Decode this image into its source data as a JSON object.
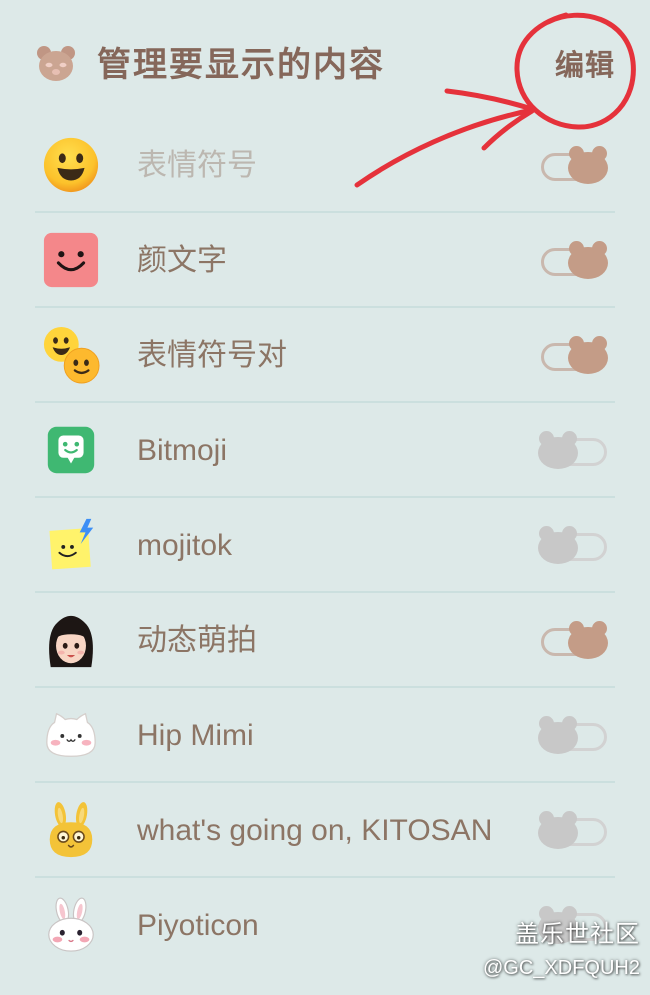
{
  "header": {
    "title": "管理要显示的内容",
    "edit_label": "编辑",
    "logo_icon": "bear-face-icon"
  },
  "items": [
    {
      "label": "表情符号",
      "icon": "smiley-emoji-icon",
      "on": true,
      "dimmed": true
    },
    {
      "label": "颜文字",
      "icon": "kaomoji-face-icon",
      "on": true,
      "dimmed": false
    },
    {
      "label": "表情符号对",
      "icon": "emoji-pair-icon",
      "on": true,
      "dimmed": false
    },
    {
      "label": "Bitmoji",
      "icon": "bitmoji-icon",
      "on": false,
      "dimmed": false
    },
    {
      "label": "mojitok",
      "icon": "mojitok-icon",
      "on": false,
      "dimmed": false
    },
    {
      "label": "动态萌拍",
      "icon": "ar-emoji-avatar-icon",
      "on": true,
      "dimmed": false
    },
    {
      "label": "Hip Mimi",
      "icon": "hip-mimi-cat-icon",
      "on": false,
      "dimmed": false
    },
    {
      "label": "what's going on, KITOSAN",
      "icon": "kitosan-bunny-icon",
      "on": false,
      "dimmed": false
    },
    {
      "label": "Piyoticon",
      "icon": "piyoticon-rabbit-icon",
      "on": false,
      "dimmed": false
    }
  ],
  "toggle_icon": "bear-knob-icon",
  "watermark": {
    "title": "盖乐世社区",
    "handle": "@GC_XDFQUH2"
  },
  "colors": {
    "background": "#dde9e8",
    "title_text": "#85675a",
    "label_text": "#8c7565",
    "label_dimmed": "#bcb7b0",
    "divider": "#cbdfde",
    "toggle_on": "#c49c87",
    "toggle_on_track": "#c9b8ae",
    "toggle_off": "#c8c8c8",
    "toggle_off_track": "#d2d2d2",
    "annotation": "#e5323b"
  }
}
